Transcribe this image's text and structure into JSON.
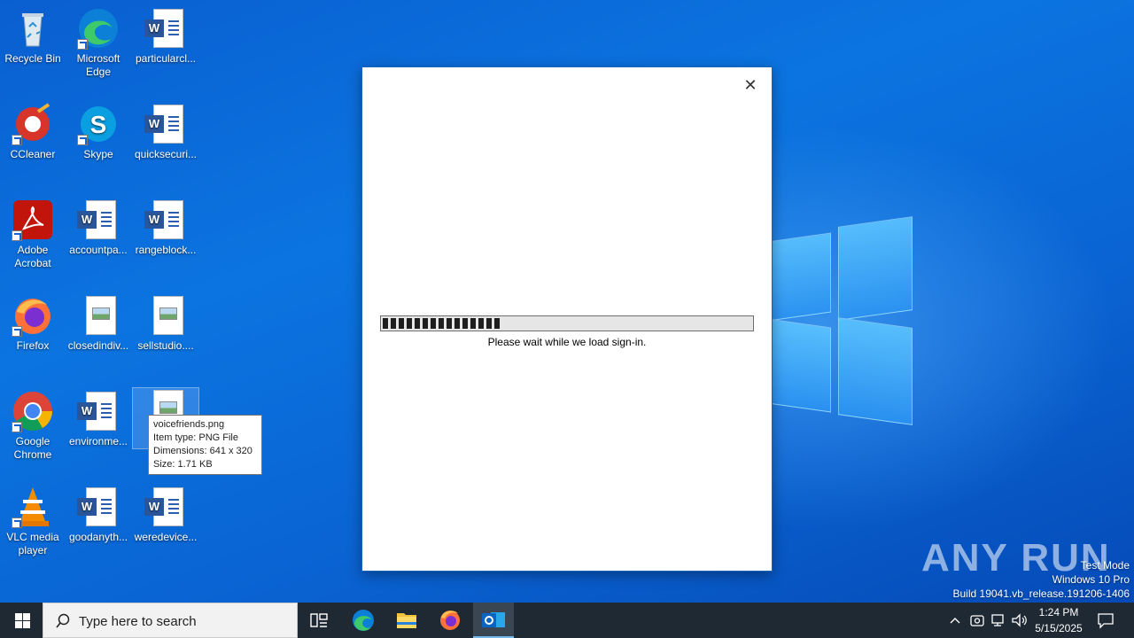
{
  "desktop": {
    "icons": [
      {
        "label": "Recycle Bin"
      },
      {
        "label": "Microsoft Edge"
      },
      {
        "label": "particularcl..."
      },
      {
        "label": "CCleaner"
      },
      {
        "label": "Skype"
      },
      {
        "label": "quicksecuri..."
      },
      {
        "label": "Adobe Acrobat"
      },
      {
        "label": "accountpa..."
      },
      {
        "label": "rangeblock..."
      },
      {
        "label": "Firefox"
      },
      {
        "label": "closedindiv..."
      },
      {
        "label": "sellstudio...."
      },
      {
        "label": "Google Chrome"
      },
      {
        "label": "environme..."
      },
      {
        "label": "vo"
      },
      {
        "label": "VLC media player"
      },
      {
        "label": "goodanyth..."
      },
      {
        "label": "weredevice..."
      }
    ]
  },
  "tooltip": {
    "name": "voicefriends.png",
    "type": "Item type: PNG File",
    "dimensions": "Dimensions: 641 x 320",
    "size": "Size: 1.71 KB"
  },
  "dialog": {
    "close_label": "✕",
    "progress_fraction": 0.32,
    "message": "Please wait while we load sign-in."
  },
  "watermark": {
    "brand": "ANY RUN"
  },
  "system": {
    "line1": "Test Mode",
    "line2": "Windows 10 Pro",
    "line3": "Build 19041.vb_release.191206-1406"
  },
  "taskbar": {
    "search_placeholder": "Type here to search",
    "time": "1:24 PM",
    "date": "5/15/2025"
  },
  "colors": {
    "accent": "#0a63d2",
    "taskbar": "#1f2933"
  }
}
